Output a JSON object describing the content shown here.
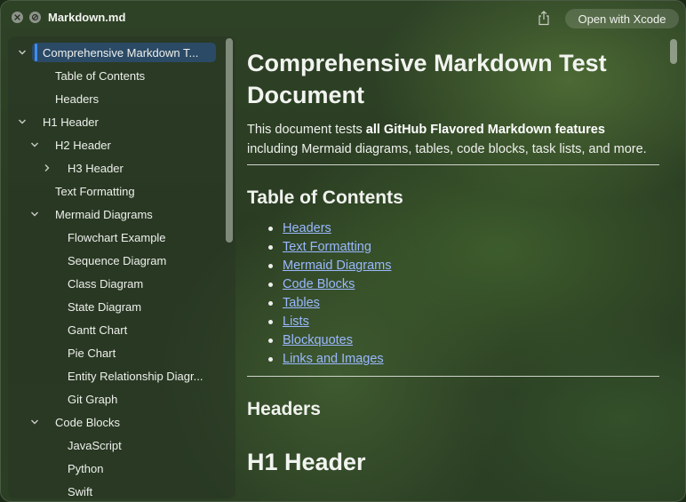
{
  "window": {
    "title": "Markdown.md",
    "open_button": "Open with Xcode"
  },
  "sidebar": {
    "items": [
      {
        "label": "Comprehensive Markdown T...",
        "chevron": "down"
      },
      {
        "label": "Table of Contents",
        "chevron": ""
      },
      {
        "label": "Headers",
        "chevron": ""
      },
      {
        "label": "H1 Header",
        "chevron": "down"
      },
      {
        "label": "H2 Header",
        "chevron": "down"
      },
      {
        "label": "H3 Header",
        "chevron": "right"
      },
      {
        "label": "Text Formatting",
        "chevron": ""
      },
      {
        "label": "Mermaid Diagrams",
        "chevron": "down"
      },
      {
        "label": "Flowchart Example",
        "chevron": ""
      },
      {
        "label": "Sequence Diagram",
        "chevron": ""
      },
      {
        "label": "Class Diagram",
        "chevron": ""
      },
      {
        "label": "State Diagram",
        "chevron": ""
      },
      {
        "label": "Gantt Chart",
        "chevron": ""
      },
      {
        "label": "Pie Chart",
        "chevron": ""
      },
      {
        "label": "Entity Relationship Diagr...",
        "chevron": ""
      },
      {
        "label": "Git Graph",
        "chevron": ""
      },
      {
        "label": "Code Blocks",
        "chevron": "down"
      },
      {
        "label": "JavaScript",
        "chevron": ""
      },
      {
        "label": "Python",
        "chevron": ""
      },
      {
        "label": "Swift",
        "chevron": ""
      }
    ]
  },
  "document": {
    "title": "Comprehensive Markdown Test Document",
    "intro_start": "This document tests ",
    "intro_bold": "all GitHub Flavored Markdown features",
    "intro_end": "including Mermaid diagrams, tables, code blocks, task lists, and more.",
    "toc_heading": "Table of Contents",
    "toc_links": [
      "Headers",
      "Text Formatting",
      "Mermaid Diagrams",
      "Code Blocks",
      "Tables",
      "Lists",
      "Blockquotes",
      "Links and Images"
    ],
    "headers_heading": "Headers",
    "h1_demo": "H1 Header"
  },
  "icons": {
    "close": "close-icon",
    "minimize": "minimize-icon",
    "share": "share-icon",
    "chevron_down": "chevron-down-icon",
    "chevron_right": "chevron-right-icon"
  },
  "colors": {
    "link": "#9ab8ff",
    "selection": "#2b4a66",
    "selection_bar": "#3f8ef0"
  }
}
